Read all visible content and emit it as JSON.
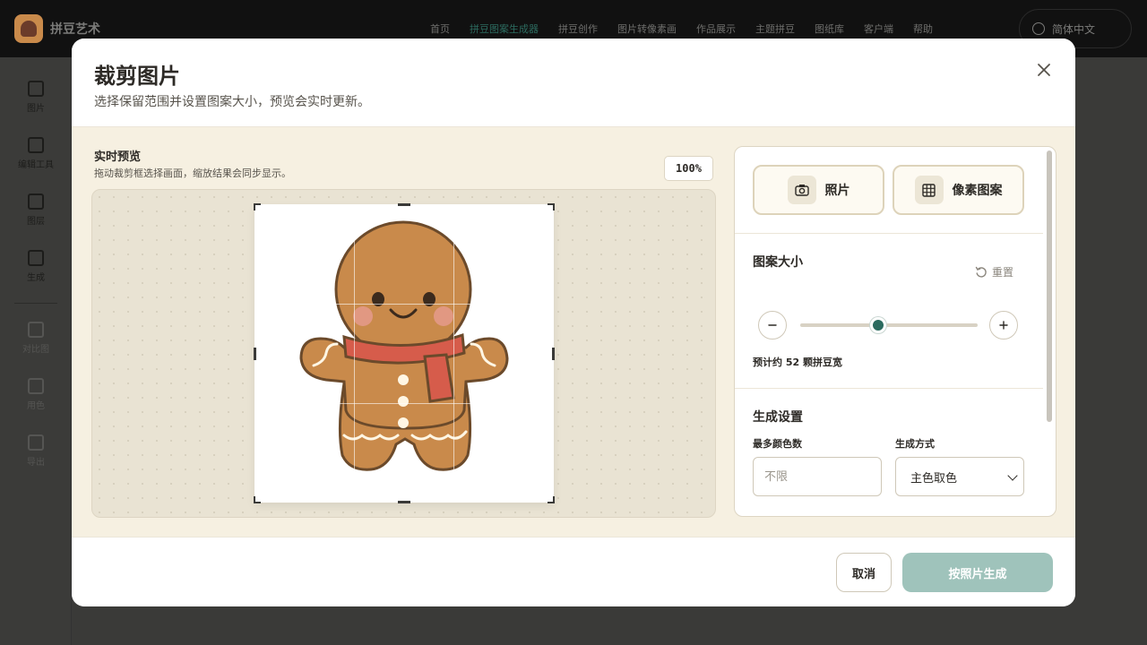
{
  "app": {
    "brand": "拼豆艺术",
    "nav": [
      "首页",
      "拼豆图案生成器",
      "拼豆创作",
      "图片转像素画",
      "作品展示",
      "主题拼豆",
      "图纸库",
      "客户端",
      "帮助"
    ],
    "active_nav": "拼豆图案生成器",
    "language": "简体中文"
  },
  "sidebar": {
    "items": [
      {
        "label": "图片",
        "icon": "image-icon"
      },
      {
        "label": "编辑工具",
        "icon": "brush-icon"
      },
      {
        "label": "图层",
        "icon": "layers-icon"
      },
      {
        "label": "生成",
        "icon": "sliders-icon"
      },
      {
        "label": "对比图",
        "icon": "compare-icon"
      },
      {
        "label": "用色",
        "icon": "palette-icon"
      },
      {
        "label": "导出",
        "icon": "download-icon"
      }
    ]
  },
  "modal": {
    "title": "裁剪图片",
    "subtitle": "选择保留范围并设置图案大小，预览会实时更新。",
    "preview": {
      "title": "实时预览",
      "hint": "拖动裁剪框选择画面，缩放结果会同步显示。",
      "zoom": "100%"
    },
    "modes": {
      "photo": "照片",
      "pixel": "像素图案"
    },
    "pattern_size": {
      "title": "图案大小",
      "reset": "重置",
      "slider_fraction": 0.44,
      "estimate": "预计约 52 颗拼豆宽"
    },
    "generation": {
      "title": "生成设置",
      "max_colors_label": "最多颜色数",
      "max_colors_placeholder": "不限",
      "method_label": "生成方式",
      "method_value": "主色取色"
    },
    "footer": {
      "cancel": "取消",
      "generate": "按照片生成"
    }
  },
  "colors": {
    "accent": "#2c6b5f",
    "generate_button": "#9fc3bb",
    "panel_bg": "#f6f0e1"
  }
}
